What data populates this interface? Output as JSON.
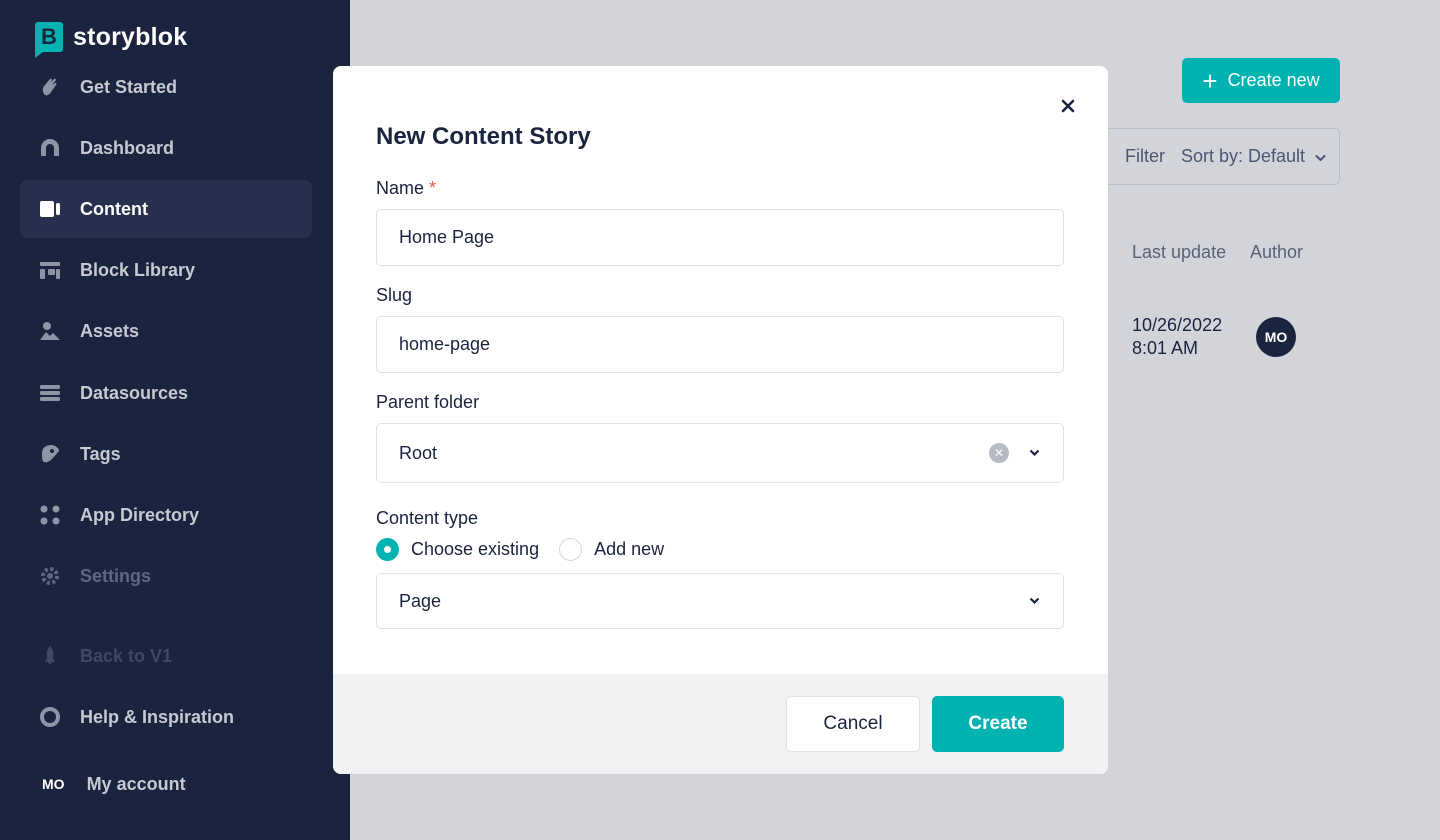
{
  "brand": {
    "name": "storyblok",
    "mark": "B",
    "accent": "#00b3b0"
  },
  "sidebar": {
    "items": [
      {
        "label": "Get Started",
        "icon": "wave-hand-icon"
      },
      {
        "label": "Dashboard",
        "icon": "dashboard-icon"
      },
      {
        "label": "Content",
        "icon": "content-icon",
        "active": true
      },
      {
        "label": "Block Library",
        "icon": "block-library-icon"
      },
      {
        "label": "Assets",
        "icon": "image-icon"
      },
      {
        "label": "Datasources",
        "icon": "list-icon"
      },
      {
        "label": "Tags",
        "icon": "tag-icon"
      },
      {
        "label": "App Directory",
        "icon": "apps-grid-icon"
      },
      {
        "label": "Settings",
        "icon": "gear-icon"
      },
      {
        "label": "Back to V1",
        "icon": "rocket-icon"
      },
      {
        "label": "Help & Inspiration",
        "icon": "lifebuoy-icon"
      }
    ],
    "account": {
      "initials": "MO",
      "label": "My account"
    }
  },
  "page": {
    "create_new": "Create new",
    "filter": "Filter",
    "sort": "Sort by: Default",
    "columns": {
      "last_update": "Last update",
      "author": "Author"
    },
    "row": {
      "date": "10/26/2022",
      "time": "8:01 AM",
      "author_initials": "MO"
    }
  },
  "modal": {
    "title": "New Content Story",
    "name": {
      "label": "Name",
      "required_mark": "*",
      "value": "Home Page"
    },
    "slug": {
      "label": "Slug",
      "value": "home-page"
    },
    "parent_folder": {
      "label": "Parent folder",
      "value": "Root"
    },
    "content_type": {
      "label": "Content type",
      "options": [
        "Choose existing",
        "Add new"
      ],
      "selected": "Choose existing",
      "value": "Page"
    },
    "cancel": "Cancel",
    "create": "Create"
  }
}
